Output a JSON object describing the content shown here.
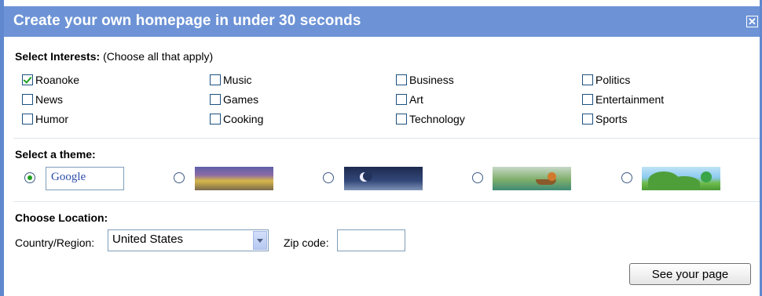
{
  "dialog": {
    "title": "Create your own homepage in under 30 seconds",
    "close_glyph": "✕"
  },
  "interests": {
    "label": "Select Interests:",
    "hint": "(Choose all that apply)",
    "items": [
      {
        "label": "Roanoke",
        "checked": true
      },
      {
        "label": "Music",
        "checked": false
      },
      {
        "label": "Business",
        "checked": false
      },
      {
        "label": "Politics",
        "checked": false
      },
      {
        "label": "News",
        "checked": false
      },
      {
        "label": "Games",
        "checked": false
      },
      {
        "label": "Art",
        "checked": false
      },
      {
        "label": "Entertainment",
        "checked": false
      },
      {
        "label": "Humor",
        "checked": false
      },
      {
        "label": "Cooking",
        "checked": false
      },
      {
        "label": "Technology",
        "checked": false
      },
      {
        "label": "Sports",
        "checked": false
      }
    ]
  },
  "theme": {
    "label": "Select a theme:",
    "google_text": "Google",
    "selected_index": 0,
    "options": [
      "google-classic",
      "sunset",
      "night-sky",
      "pond-fox",
      "green-hills"
    ]
  },
  "location": {
    "label": "Choose Location:",
    "country_label": "Country/Region:",
    "country_value": "United States",
    "zip_label": "Zip code:",
    "zip_value": ""
  },
  "actions": {
    "see_page_label": "See your page"
  },
  "colors": {
    "titlebar": "#6d93d6",
    "check": "#21a121"
  }
}
